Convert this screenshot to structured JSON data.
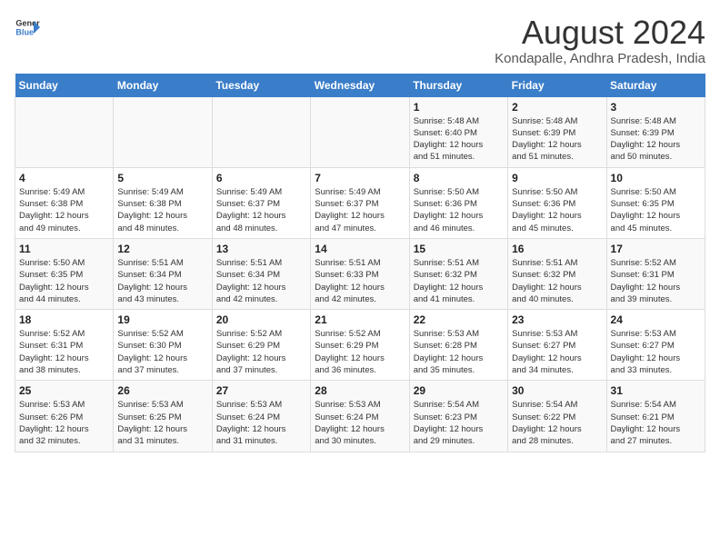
{
  "logo": {
    "line1": "General",
    "line2": "Blue"
  },
  "title": "August 2024",
  "subtitle": "Kondapalle, Andhra Pradesh, India",
  "headers": [
    "Sunday",
    "Monday",
    "Tuesday",
    "Wednesday",
    "Thursday",
    "Friday",
    "Saturday"
  ],
  "weeks": [
    [
      {
        "day": "",
        "info": ""
      },
      {
        "day": "",
        "info": ""
      },
      {
        "day": "",
        "info": ""
      },
      {
        "day": "",
        "info": ""
      },
      {
        "day": "1",
        "info": "Sunrise: 5:48 AM\nSunset: 6:40 PM\nDaylight: 12 hours\nand 51 minutes."
      },
      {
        "day": "2",
        "info": "Sunrise: 5:48 AM\nSunset: 6:39 PM\nDaylight: 12 hours\nand 51 minutes."
      },
      {
        "day": "3",
        "info": "Sunrise: 5:48 AM\nSunset: 6:39 PM\nDaylight: 12 hours\nand 50 minutes."
      }
    ],
    [
      {
        "day": "4",
        "info": "Sunrise: 5:49 AM\nSunset: 6:38 PM\nDaylight: 12 hours\nand 49 minutes."
      },
      {
        "day": "5",
        "info": "Sunrise: 5:49 AM\nSunset: 6:38 PM\nDaylight: 12 hours\nand 48 minutes."
      },
      {
        "day": "6",
        "info": "Sunrise: 5:49 AM\nSunset: 6:37 PM\nDaylight: 12 hours\nand 48 minutes."
      },
      {
        "day": "7",
        "info": "Sunrise: 5:49 AM\nSunset: 6:37 PM\nDaylight: 12 hours\nand 47 minutes."
      },
      {
        "day": "8",
        "info": "Sunrise: 5:50 AM\nSunset: 6:36 PM\nDaylight: 12 hours\nand 46 minutes."
      },
      {
        "day": "9",
        "info": "Sunrise: 5:50 AM\nSunset: 6:36 PM\nDaylight: 12 hours\nand 45 minutes."
      },
      {
        "day": "10",
        "info": "Sunrise: 5:50 AM\nSunset: 6:35 PM\nDaylight: 12 hours\nand 45 minutes."
      }
    ],
    [
      {
        "day": "11",
        "info": "Sunrise: 5:50 AM\nSunset: 6:35 PM\nDaylight: 12 hours\nand 44 minutes."
      },
      {
        "day": "12",
        "info": "Sunrise: 5:51 AM\nSunset: 6:34 PM\nDaylight: 12 hours\nand 43 minutes."
      },
      {
        "day": "13",
        "info": "Sunrise: 5:51 AM\nSunset: 6:34 PM\nDaylight: 12 hours\nand 42 minutes."
      },
      {
        "day": "14",
        "info": "Sunrise: 5:51 AM\nSunset: 6:33 PM\nDaylight: 12 hours\nand 42 minutes."
      },
      {
        "day": "15",
        "info": "Sunrise: 5:51 AM\nSunset: 6:32 PM\nDaylight: 12 hours\nand 41 minutes."
      },
      {
        "day": "16",
        "info": "Sunrise: 5:51 AM\nSunset: 6:32 PM\nDaylight: 12 hours\nand 40 minutes."
      },
      {
        "day": "17",
        "info": "Sunrise: 5:52 AM\nSunset: 6:31 PM\nDaylight: 12 hours\nand 39 minutes."
      }
    ],
    [
      {
        "day": "18",
        "info": "Sunrise: 5:52 AM\nSunset: 6:31 PM\nDaylight: 12 hours\nand 38 minutes."
      },
      {
        "day": "19",
        "info": "Sunrise: 5:52 AM\nSunset: 6:30 PM\nDaylight: 12 hours\nand 37 minutes."
      },
      {
        "day": "20",
        "info": "Sunrise: 5:52 AM\nSunset: 6:29 PM\nDaylight: 12 hours\nand 37 minutes."
      },
      {
        "day": "21",
        "info": "Sunrise: 5:52 AM\nSunset: 6:29 PM\nDaylight: 12 hours\nand 36 minutes."
      },
      {
        "day": "22",
        "info": "Sunrise: 5:53 AM\nSunset: 6:28 PM\nDaylight: 12 hours\nand 35 minutes."
      },
      {
        "day": "23",
        "info": "Sunrise: 5:53 AM\nSunset: 6:27 PM\nDaylight: 12 hours\nand 34 minutes."
      },
      {
        "day": "24",
        "info": "Sunrise: 5:53 AM\nSunset: 6:27 PM\nDaylight: 12 hours\nand 33 minutes."
      }
    ],
    [
      {
        "day": "25",
        "info": "Sunrise: 5:53 AM\nSunset: 6:26 PM\nDaylight: 12 hours\nand 32 minutes."
      },
      {
        "day": "26",
        "info": "Sunrise: 5:53 AM\nSunset: 6:25 PM\nDaylight: 12 hours\nand 31 minutes."
      },
      {
        "day": "27",
        "info": "Sunrise: 5:53 AM\nSunset: 6:24 PM\nDaylight: 12 hours\nand 31 minutes."
      },
      {
        "day": "28",
        "info": "Sunrise: 5:53 AM\nSunset: 6:24 PM\nDaylight: 12 hours\nand 30 minutes."
      },
      {
        "day": "29",
        "info": "Sunrise: 5:54 AM\nSunset: 6:23 PM\nDaylight: 12 hours\nand 29 minutes."
      },
      {
        "day": "30",
        "info": "Sunrise: 5:54 AM\nSunset: 6:22 PM\nDaylight: 12 hours\nand 28 minutes."
      },
      {
        "day": "31",
        "info": "Sunrise: 5:54 AM\nSunset: 6:21 PM\nDaylight: 12 hours\nand 27 minutes."
      }
    ]
  ]
}
